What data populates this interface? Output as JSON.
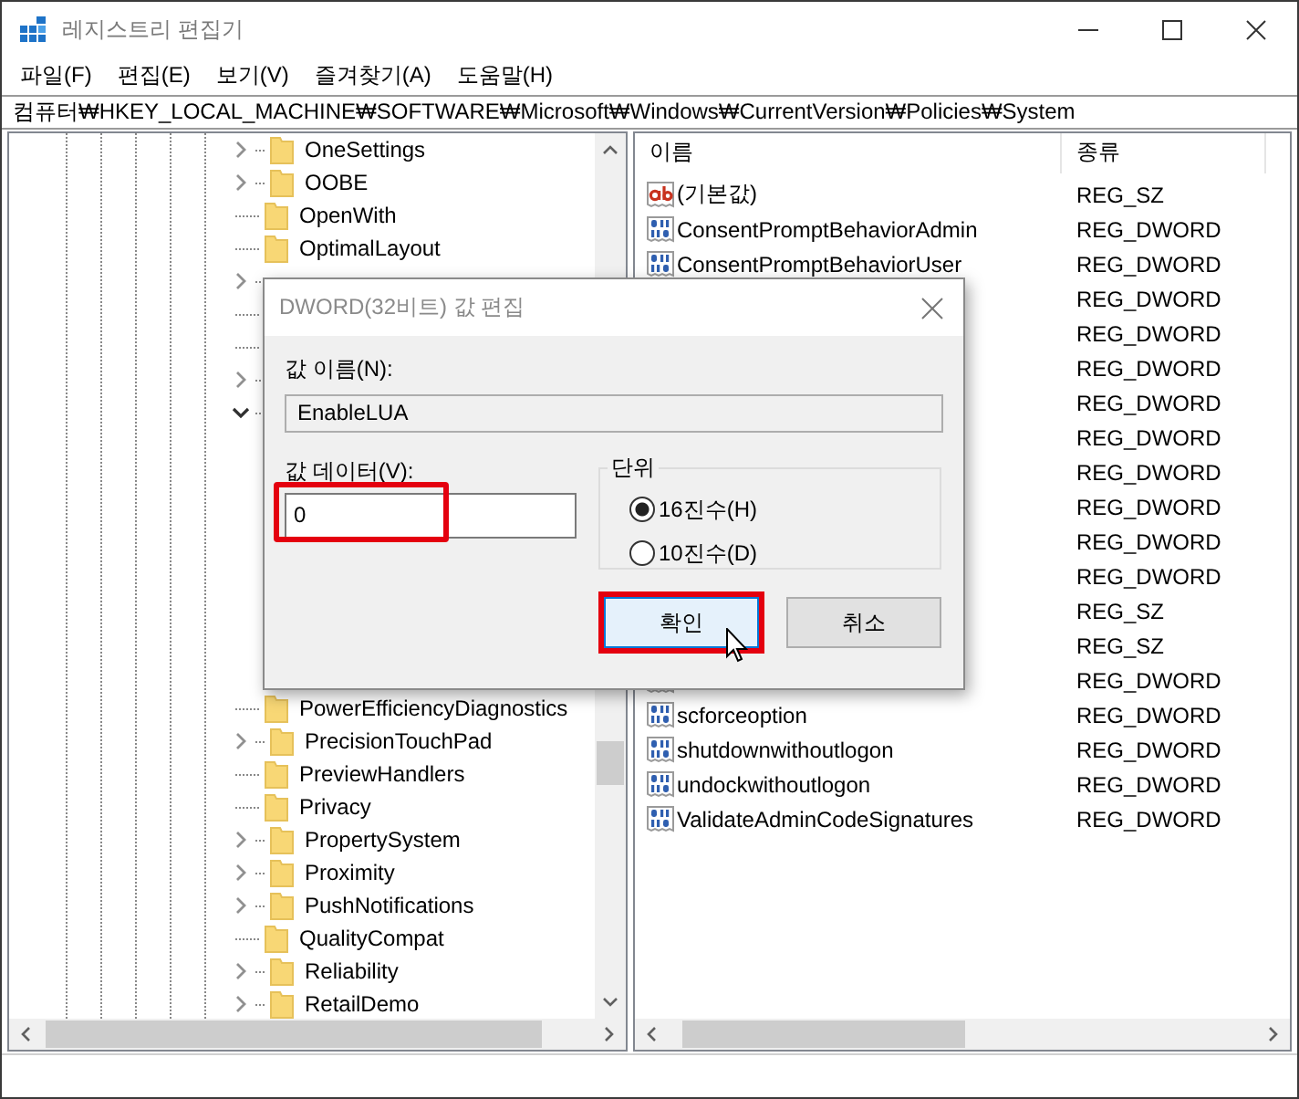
{
  "window": {
    "title": "레지스트리 편집기"
  },
  "menu": [
    "파일(F)",
    "편집(E)",
    "보기(V)",
    "즐겨찾기(A)",
    "도움말(H)"
  ],
  "address": "컴퓨터₩HKEY_LOCAL_MACHINE₩SOFTWARE₩Microsoft₩Windows₩CurrentVersion₩Policies₩System",
  "tree": {
    "items": [
      {
        "label": "OneSettings",
        "has_children": true,
        "expanded": false
      },
      {
        "label": "OOBE",
        "has_children": true,
        "expanded": false
      },
      {
        "label": "OpenWith",
        "has_children": false
      },
      {
        "label": "OptimalLayout",
        "has_children": false
      },
      {
        "has_children": true,
        "expanded": false
      },
      {
        "has_children": false
      },
      {
        "has_children": false
      },
      {
        "has_children": true,
        "expanded": false
      },
      {
        "has_children": true,
        "expanded": true
      },
      {
        "label": "PowerEfficiencyDiagnostics",
        "has_children": false
      },
      {
        "label": "PrecisionTouchPad",
        "has_children": true,
        "expanded": false
      },
      {
        "label": "PreviewHandlers",
        "has_children": false
      },
      {
        "label": "Privacy",
        "has_children": false
      },
      {
        "label": "PropertySystem",
        "has_children": true,
        "expanded": false
      },
      {
        "label": "Proximity",
        "has_children": true,
        "expanded": false
      },
      {
        "label": "PushNotifications",
        "has_children": true,
        "expanded": false
      },
      {
        "label": "QualityCompat",
        "has_children": false
      },
      {
        "label": "Reliability",
        "has_children": true,
        "expanded": false
      },
      {
        "label": "RetailDemo",
        "has_children": true,
        "expanded": false
      }
    ]
  },
  "list": {
    "columns": [
      "이름",
      "종류"
    ],
    "rows": [
      {
        "kind": "string",
        "name": "(기본값)",
        "type": "REG_SZ"
      },
      {
        "kind": "dword",
        "name": "ConsentPromptBehaviorAdmin",
        "type": "REG_DWORD"
      },
      {
        "kind": "dword",
        "name": "ConsentPromptBehaviorUser",
        "type": "REG_DWORD"
      },
      {
        "type": "REG_DWORD"
      },
      {
        "type": "REG_DWORD"
      },
      {
        "type": "REG_DWORD"
      },
      {
        "type": "REG_DWORD"
      },
      {
        "type": "REG_DWORD"
      },
      {
        "type": "REG_DWORD"
      },
      {
        "type": "REG_DWORD"
      },
      {
        "type": "REG_DWORD"
      },
      {
        "type": "REG_DWORD"
      },
      {
        "type": "REG_SZ"
      },
      {
        "type": "REG_SZ"
      },
      {
        "kind": "dword",
        "type": "REG_DWORD"
      },
      {
        "kind": "dword",
        "name": "scforceoption",
        "type": "REG_DWORD"
      },
      {
        "kind": "dword",
        "name": "shutdownwithoutlogon",
        "type": "REG_DWORD"
      },
      {
        "kind": "dword",
        "name": "undockwithoutlogon",
        "type": "REG_DWORD"
      },
      {
        "kind": "dword",
        "name": "ValidateAdminCodeSignatures",
        "type": "REG_DWORD"
      }
    ]
  },
  "dialog": {
    "title": "DWORD(32비트) 값 편집",
    "name_label": "값 이름(N):",
    "name_value": "EnableLUA",
    "name_read_only": true,
    "data_label": "값 데이터(V):",
    "data_value": "0",
    "data_highlighted": true,
    "base": {
      "title": "단위",
      "options": [
        {
          "label": "16진수(H)",
          "selected": true
        },
        {
          "label": "10진수(D)",
          "selected": false
        }
      ]
    },
    "buttons": [
      {
        "label": "확인",
        "default": true,
        "highlighted": true
      },
      {
        "label": "취소",
        "default": false,
        "highlighted": false
      }
    ]
  }
}
